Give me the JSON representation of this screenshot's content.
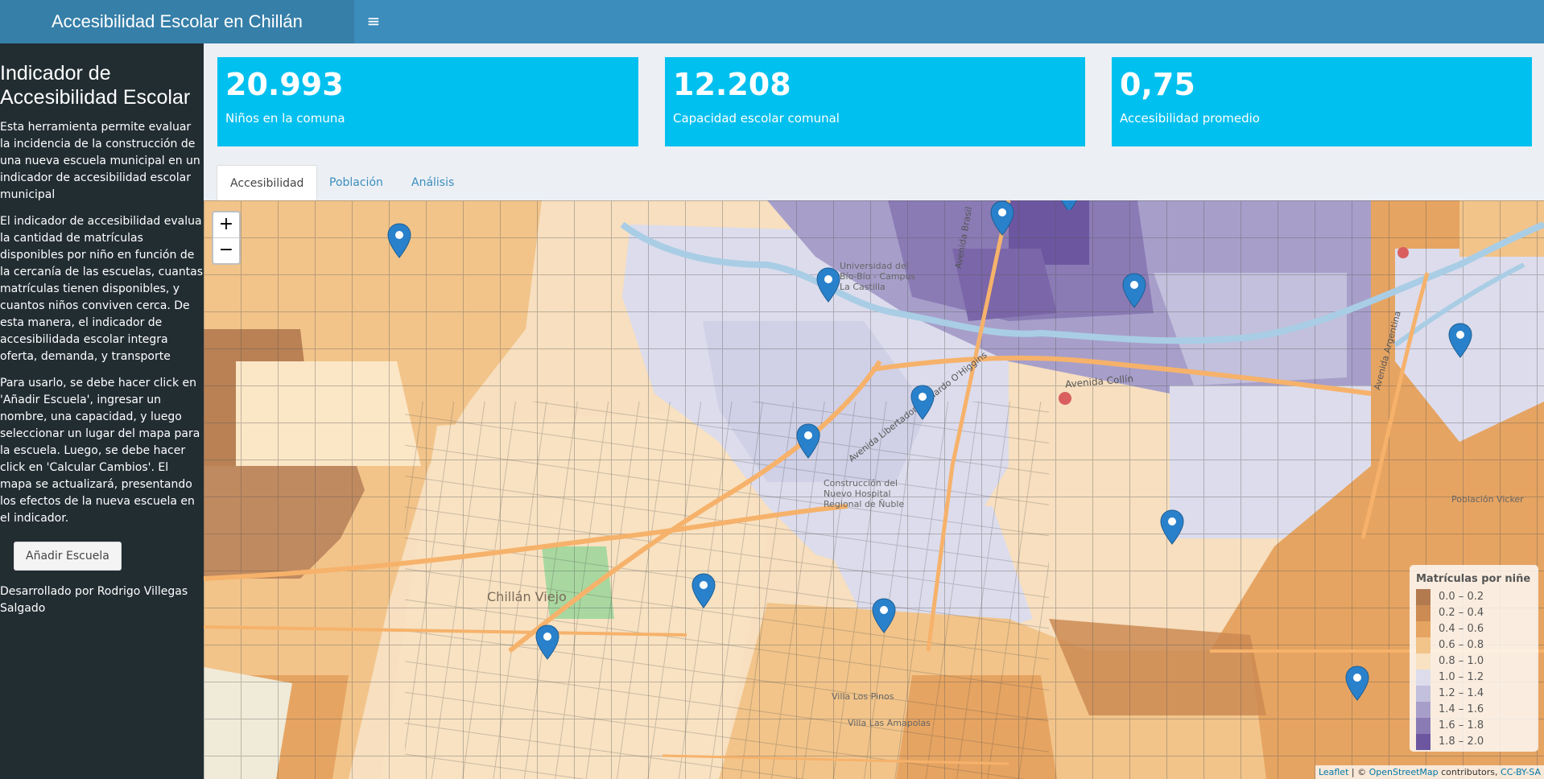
{
  "header": {
    "title": "Accesibilidad Escolar en Chillán",
    "menu_icon": "hamburger-icon"
  },
  "sidebar": {
    "heading": "Indicador de Accesibilidad Escolar",
    "paragraphs": [
      "Esta herramienta permite evaluar la incidencia de la construcción de una nueva escuela municipal en un indicador de accesibilidad escolar municipal",
      "El indicador de accesibilidad evalua la cantidad de matrículas disponibles por niño en función de la cercanía de las escuelas, cuantas matrículas tienen disponibles, y cuantos niños conviven cerca. De esta manera, el indicador de accesibilidada escolar integra oferta, demanda, y transporte",
      "Para usarlo, se debe hacer click en 'Añadir Escuela', ingresar un nombre, una capacidad, y luego seleccionar un lugar del mapa para la escuela. Luego, se debe hacer click en 'Calcular Cambios'. El mapa se actualizará, presentando los efectos de la nueva escuela en el indicador."
    ],
    "add_button": "Añadir Escuela",
    "developer": "Desarrollado por Rodrigo Villegas Salgado"
  },
  "value_boxes": [
    {
      "value": "20.993",
      "label": "Niños en la comuna"
    },
    {
      "value": "12.208",
      "label": "Capacidad escolar comunal"
    },
    {
      "value": "0,75",
      "label": "Accesibilidad promedio"
    }
  ],
  "tabs": [
    "Accesibilidad",
    "Población",
    "Análisis"
  ],
  "active_tab": "Accesibilidad",
  "map": {
    "zoom_in": "+",
    "zoom_out": "−",
    "place_labels": [
      "Chillán Viejo",
      "Avenida Collín",
      "Avenida Libertador Bernardo O'Higgins",
      "Avenida Brasil",
      "Avenida Argentina",
      "Universidad del Bío-Bío - Campus La Castilla",
      "Construcción del Nuevo Hospital Regional de Ñuble",
      "Población Vicker",
      "Villa Los Pinos",
      "Villa Las Amapolas"
    ],
    "marker_count": 13,
    "marker_color": "#2a81cb",
    "legend": {
      "title": "Matrículas por niñe",
      "items": [
        {
          "range": "0.0 – 0.2",
          "color": "#b27a4e"
        },
        {
          "range": "0.2 – 0.4",
          "color": "#cc8b52"
        },
        {
          "range": "0.4 – 0.6",
          "color": "#e6a462"
        },
        {
          "range": "0.6 – 0.8",
          "color": "#f2c48a"
        },
        {
          "range": "0.8 – 1.0",
          "color": "#f8e2c2"
        },
        {
          "range": "1.0 – 1.2",
          "color": "#dcdcec"
        },
        {
          "range": "1.2 – 1.4",
          "color": "#c2c0dc"
        },
        {
          "range": "1.4 – 1.6",
          "color": "#a79fca"
        },
        {
          "range": "1.6 – 1.8",
          "color": "#8a7bb5"
        },
        {
          "range": "1.8 – 2.0",
          "color": "#6d56a0"
        }
      ]
    },
    "attribution": {
      "leaflet": "Leaflet",
      "sep": " | © ",
      "osm": "OpenStreetMap",
      "contrib": " contributors, ",
      "license": "CC-BY-SA"
    }
  }
}
